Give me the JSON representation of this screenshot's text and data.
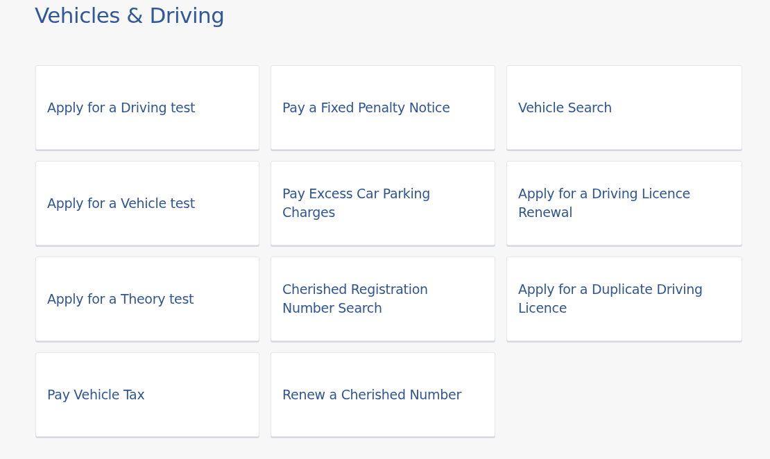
{
  "page": {
    "title": "Vehicles & Driving"
  },
  "services": [
    {
      "label": "Apply for a Driving test"
    },
    {
      "label": "Pay a Fixed Penalty Notice"
    },
    {
      "label": "Vehicle Search"
    },
    {
      "label": "Apply for a Vehicle test"
    },
    {
      "label": "Pay Excess Car Parking Charges"
    },
    {
      "label": "Apply for a Driving Licence Renewal"
    },
    {
      "label": "Apply for a Theory test"
    },
    {
      "label": "Cherished Registration Number Search"
    },
    {
      "label": "Apply for a Duplicate Driving Licence"
    },
    {
      "label": "Pay Vehicle Tax"
    },
    {
      "label": "Renew a Cherished Number"
    }
  ]
}
